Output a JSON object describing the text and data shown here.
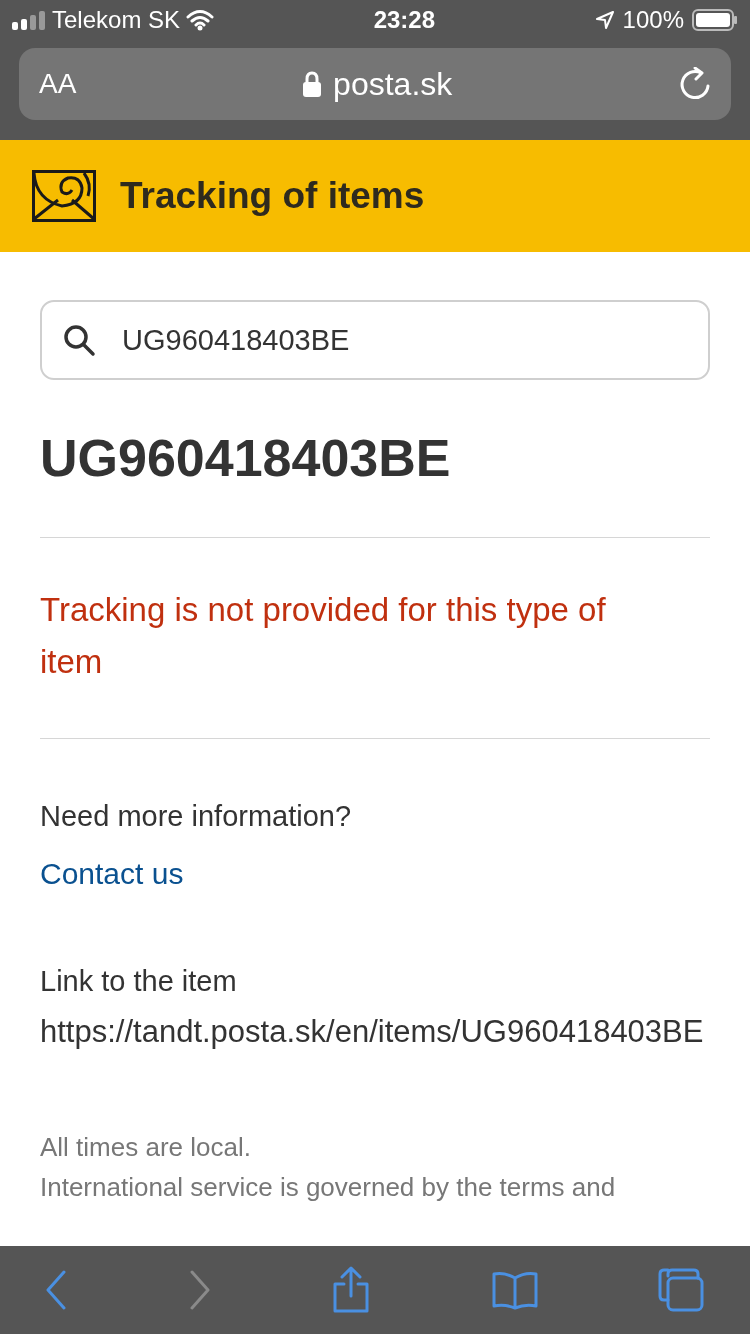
{
  "status_bar": {
    "carrier": "Telekom SK",
    "time": "23:28",
    "battery": "100%"
  },
  "address_bar": {
    "text_size_label": "AA",
    "url": "posta.sk"
  },
  "header": {
    "title": "Tracking of items"
  },
  "search": {
    "value": "UG960418403BE"
  },
  "item_number": "UG960418403BE",
  "error_message": "Tracking is not provided for this type of item",
  "help": {
    "question": "Need more information?",
    "link": "Contact us"
  },
  "item_link": {
    "label": "Link to the item",
    "url": "https://tandt.posta.sk/en/items/UG960418403BE"
  },
  "footer_notes": [
    "All times are local.",
    "International service is governed by the terms and"
  ],
  "toolbar": [
    {
      "kind": "back",
      "disabled": false
    },
    {
      "kind": "forward",
      "disabled": true
    },
    {
      "kind": "share",
      "disabled": false
    },
    {
      "kind": "bookmarks",
      "disabled": false
    },
    {
      "kind": "tabs",
      "disabled": false
    }
  ]
}
